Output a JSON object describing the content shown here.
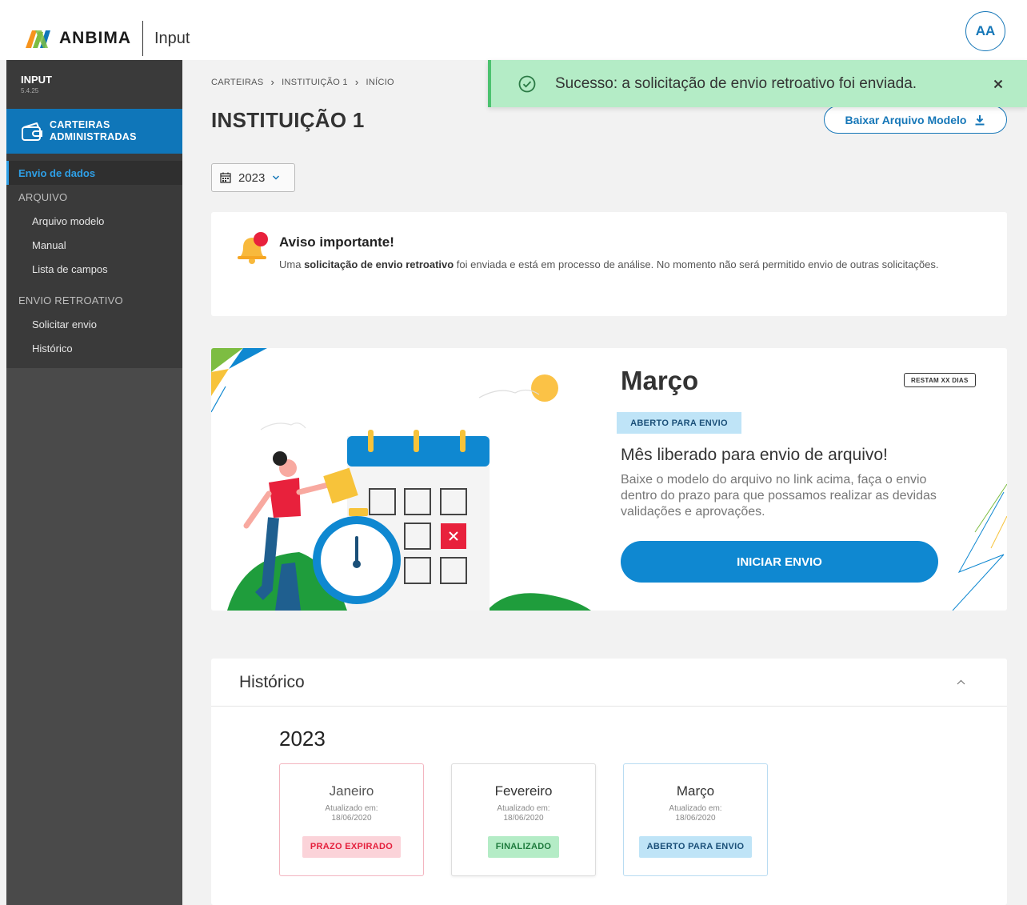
{
  "header": {
    "brand": "ANBIMA",
    "product": "Input",
    "avatar_initials": "AA",
    "brand_colors": {
      "green": "#7dbd42",
      "orange": "#f7941d",
      "blue": "#0f76b9"
    }
  },
  "sidebar": {
    "app_name": "INPUT",
    "app_version": "5.4.25",
    "section_line1": "CARTEIRAS",
    "section_line2": "ADMINISTRADAS",
    "items": [
      {
        "label": "Envio de dados",
        "type": "item",
        "active": true
      },
      {
        "label": "ARQUIVO",
        "type": "group"
      },
      {
        "label": "Arquivo modelo",
        "type": "item"
      },
      {
        "label": "Manual",
        "type": "item"
      },
      {
        "label": "Lista de campos",
        "type": "item"
      },
      {
        "label": "ENVIO RETROATIVO",
        "type": "group"
      },
      {
        "label": "Solicitar envio",
        "type": "item"
      },
      {
        "label": "Histórico",
        "type": "item"
      }
    ]
  },
  "breadcrumb": [
    "CARTEIRAS",
    "INSTITUIÇÃO 1",
    "INÍCIO"
  ],
  "page_title": "INSTITUIÇÃO 1",
  "download_button": "Baixar Arquivo Modelo",
  "year_select": {
    "value": "2023"
  },
  "toast": {
    "message": "Sucesso: a solicitação de envio retroativo foi enviada.",
    "color": "#b4ecc6"
  },
  "notice": {
    "title": "Aviso importante!",
    "text_pre": "Uma ",
    "text_bold": "solicitação de  envio retroativo",
    "text_post": " foi enviada e está em processo de análise. No momento não será permitido envio de outras solicitações."
  },
  "month_card": {
    "month": "Março",
    "days_left": "RESTAM XX DIAS",
    "status": "ABERTO PARA ENVIO",
    "heading": "Mês liberado para envio de arquivo!",
    "description": "Baixe o modelo do arquivo no link acima, faça o envio dentro do prazo para que possamos realizar as devidas validações e aprovações.",
    "button": "INICIAR ENVIO"
  },
  "history": {
    "title": "Histórico",
    "year": "2023",
    "cards": [
      {
        "month": "Janeiro",
        "updated_label": "Atualizado em:",
        "updated_date": "18/06/2020",
        "status": "PRAZO EXPIRADO",
        "status_color": "#e41f3c"
      },
      {
        "month": "Fevereiro",
        "updated_label": "Atualizado em:",
        "updated_date": "18/06/2020",
        "status": "FINALIZADO",
        "status_color": "#1d7a3c"
      },
      {
        "month": "Março",
        "updated_label": "Atualizado em:",
        "updated_date": "18/06/2020",
        "status": "ABERTO PARA ENVIO",
        "status_color": "#1a4f78"
      }
    ]
  }
}
